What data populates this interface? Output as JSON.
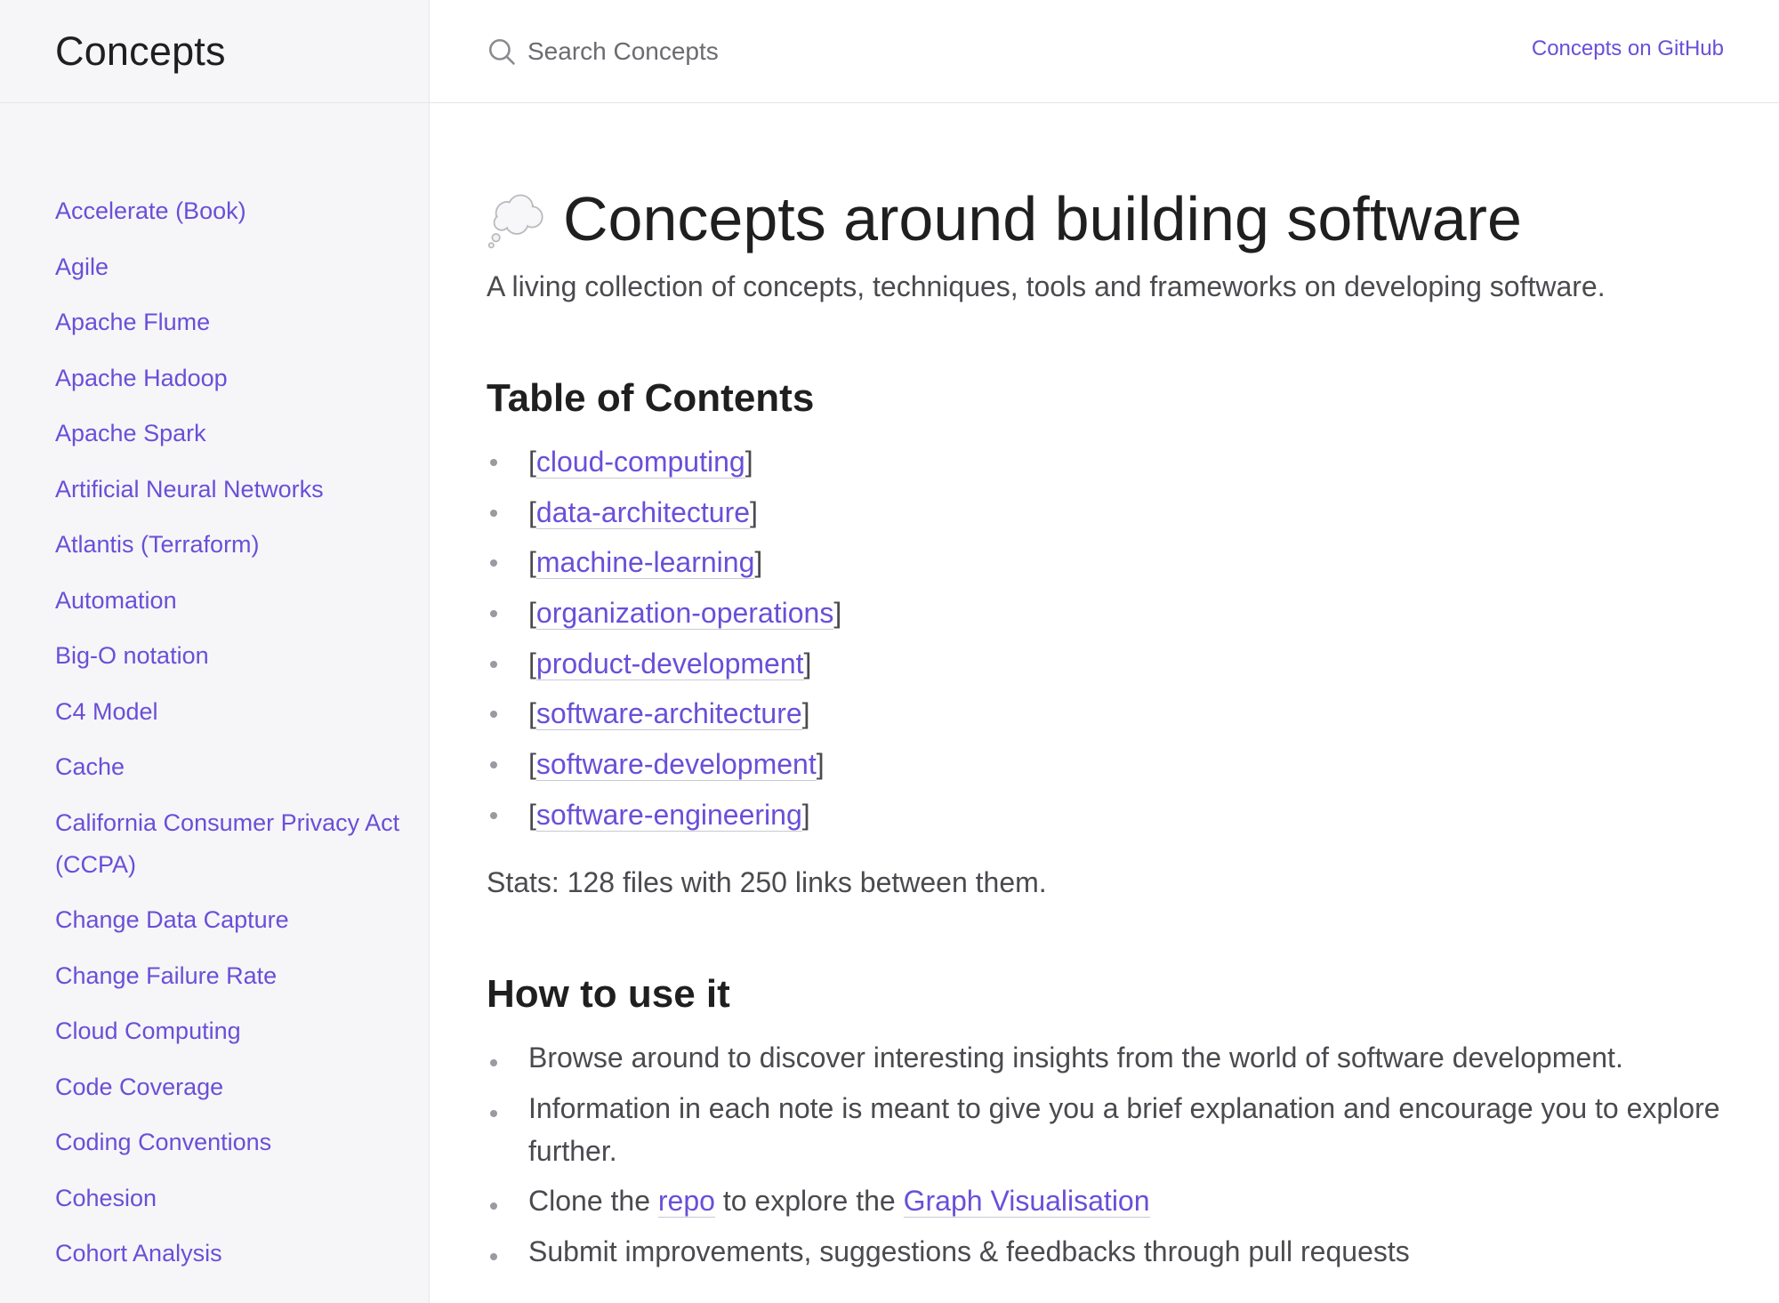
{
  "app": {
    "title": "Concepts"
  },
  "search": {
    "placeholder": "Search Concepts"
  },
  "header": {
    "github_link": "Concepts on GitHub"
  },
  "sidebar": {
    "items": [
      "Accelerate (Book)",
      "Agile",
      "Apache Flume",
      "Apache Hadoop",
      "Apache Spark",
      "Artificial Neural Networks",
      "Atlantis (Terraform)",
      "Automation",
      "Big-O notation",
      "C4 Model",
      "Cache",
      "California Consumer Privacy Act (CCPA)",
      "Change Data Capture",
      "Change Failure Rate",
      "Cloud Computing",
      "Code Coverage",
      "Coding Conventions",
      "Cohesion",
      "Cohort Analysis"
    ]
  },
  "main": {
    "title": "Concepts around building software",
    "title_icon": "thought-balloon-icon",
    "subtitle": "A living collection of concepts, techniques, tools and frameworks on developing software.",
    "toc_heading": "Table of Contents",
    "toc": [
      "cloud-computing",
      "data-architecture",
      "machine-learning",
      "organization-operations",
      "product-development",
      "software-architecture",
      "software-development",
      "software-engineering"
    ],
    "stats": "Stats: 128 files with 250 links between them.",
    "howto_heading": "How to use it",
    "howto": {
      "item1": "Browse around to discover interesting insights from the world of software development.",
      "item2": "Information in each note is meant to give you a brief explanation and encourage you to explore further.",
      "item3_pre": "Clone the ",
      "item3_link1": "repo",
      "item3_mid": " to explore the ",
      "item3_link2": "Graph Visualisation",
      "item4": "Submit improvements, suggestions & feedbacks through pull requests"
    }
  },
  "colors": {
    "link": "#6a4fd8",
    "sidebar_bg": "#f6f6f8",
    "text": "#4a4a4f",
    "heading": "#1f1f1f"
  }
}
